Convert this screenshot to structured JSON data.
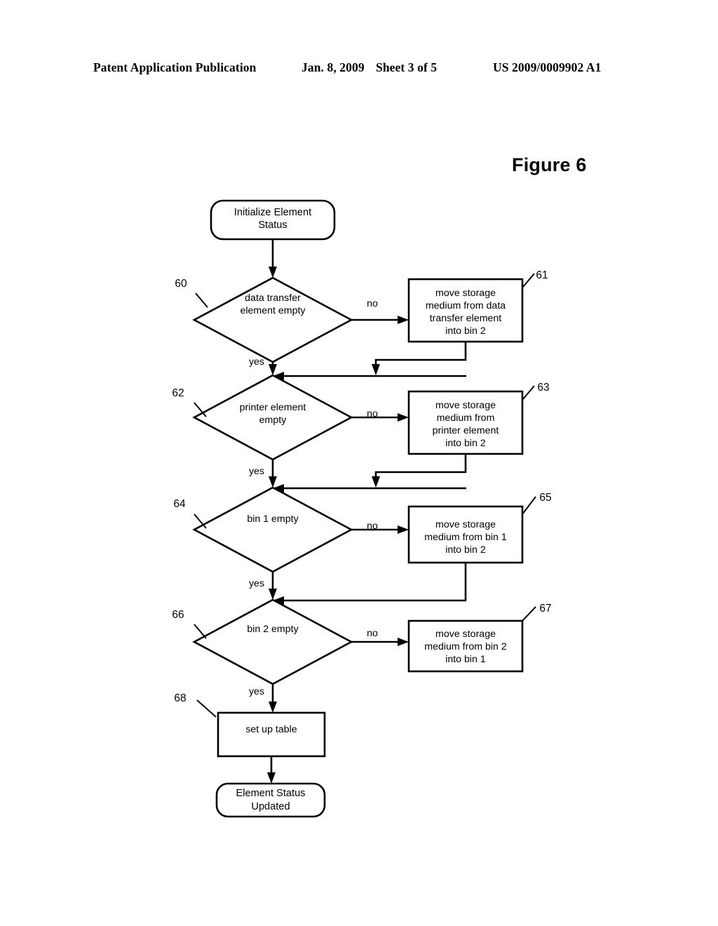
{
  "header": {
    "publication": "Patent Application Publication",
    "date": "Jan. 8, 2009",
    "sheet": "Sheet 3 of 5",
    "patent_number": "US 2009/0009902 A1"
  },
  "figure": {
    "title": "Figure 6"
  },
  "flowchart": {
    "start_terminator": {
      "ref": "",
      "lines": [
        "Initialize Element",
        "Status"
      ]
    },
    "end_terminator": {
      "ref": "",
      "lines": [
        "Element Status",
        "Updated"
      ]
    },
    "decisions": [
      {
        "ref": "60",
        "lines": [
          "data transfer",
          "element empty"
        ],
        "yes_label": "yes",
        "no_label": "no"
      },
      {
        "ref": "62",
        "lines": [
          "printer element",
          "empty"
        ],
        "yes_label": "yes",
        "no_label": "no"
      },
      {
        "ref": "64",
        "lines": [
          "bin 1 empty"
        ],
        "yes_label": "yes",
        "no_label": "no"
      },
      {
        "ref": "66",
        "lines": [
          "bin 2 empty"
        ],
        "yes_label": "yes",
        "no_label": "no"
      }
    ],
    "actions": [
      {
        "ref": "61",
        "lines": [
          "move storage",
          "medium from data",
          "transfer element",
          "into bin 2"
        ]
      },
      {
        "ref": "63",
        "lines": [
          "move storage",
          "medium from",
          "printer element",
          "into bin 2"
        ]
      },
      {
        "ref": "65",
        "lines": [
          "move storage",
          "medium from bin 1",
          "into bin 2"
        ]
      },
      {
        "ref": "67",
        "lines": [
          "move storage",
          "medium from bin 2",
          "into bin 1"
        ]
      }
    ],
    "process": {
      "ref": "68",
      "lines": [
        "set up table"
      ]
    }
  }
}
